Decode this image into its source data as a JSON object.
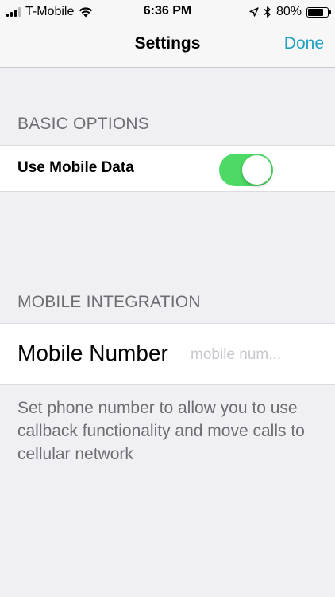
{
  "status_bar": {
    "carrier": "T-Mobile",
    "time": "6:36 PM",
    "battery_percent": "80%",
    "battery_level": 0.8,
    "icons": [
      "signal-icon",
      "wifi-icon",
      "location-arrow-icon",
      "bluetooth-icon",
      "battery-icon"
    ]
  },
  "nav": {
    "title": "Settings",
    "done_label": "Done"
  },
  "sections": {
    "basic": {
      "header": "BASIC OPTIONS",
      "mobile_data_label": "Use Mobile Data",
      "mobile_data_on": true
    },
    "integration": {
      "header": "MOBILE INTEGRATION",
      "mobile_number_label": "Mobile Number",
      "mobile_number_value": "",
      "mobile_number_placeholder": "mobile num...",
      "footer": "Set phone number to allow you to use callback functionality and move calls to cellular network"
    }
  },
  "colors": {
    "accent": "#1fa1bf",
    "toggle_on": "#4cd964",
    "background": "#efeff4",
    "header_text": "#6d6d72"
  }
}
